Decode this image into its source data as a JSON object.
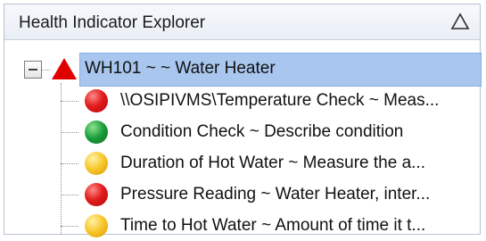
{
  "panel": {
    "title": "Health Indicator Explorer",
    "collapse_icon": "triangle-up-outline-icon"
  },
  "tree": {
    "root": {
      "label": "WH101 ~  ~ Water Heater",
      "status_icon": "warning-triangle-icon",
      "status_color": "#e00000",
      "expanded": true,
      "selected": true
    },
    "children": [
      {
        "label": "\\\\OSIPIVMS\\Temperature Check ~ Meas...",
        "status": "red",
        "color": "#e21d1d"
      },
      {
        "label": "Condition Check ~ Describe condition",
        "status": "green",
        "color": "#1a9c3a"
      },
      {
        "label": "Duration of Hot Water ~ Measure the a...",
        "status": "yellow",
        "color": "#f7c526"
      },
      {
        "label": "Pressure Reading ~ Water Heater, inter...",
        "status": "red",
        "color": "#e21d1d"
      },
      {
        "label": "Time to Hot Water ~ Amount of time it t...",
        "status": "yellow",
        "color": "#f7c526"
      }
    ]
  }
}
